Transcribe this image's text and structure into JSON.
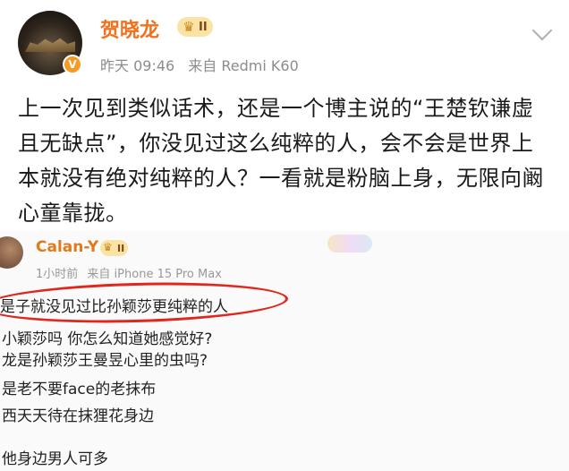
{
  "post": {
    "author": "贺晓龙",
    "level_badge": "II",
    "time": "昨天 09:46",
    "source": "来自 Redmi K60",
    "body": "上一次见到类似话术，还是一个博主说的“王楚钦谦虚且无缺点”，你没见过这么纯粹的人，会不会是世界上本就没有绝对纯粹的人？一看就是粉脑上身，无限向阚心童靠拢。"
  },
  "embedded": {
    "author": "Calan-Y",
    "level_badge": "II",
    "time": "1小时前",
    "source": "来自 iPhone 15 Pro Max",
    "lines": [
      "是子就没见过比孙颖莎更纯粹的人",
      "小颖莎吗 你怎么知道她感觉好?",
      "龙是孙颖莎王曼昱心里的虫吗?",
      "是老不要face的老抹布",
      "西天天待在抹狸花身边",
      "他身边男人可多"
    ]
  },
  "colors": {
    "username": "#f2711c",
    "meta": "#8c8c8c",
    "highlight": "#e0261d"
  },
  "icons": {
    "verified": "v-badge-icon",
    "crown": "crown-icon",
    "more": "chevron-down-icon"
  }
}
